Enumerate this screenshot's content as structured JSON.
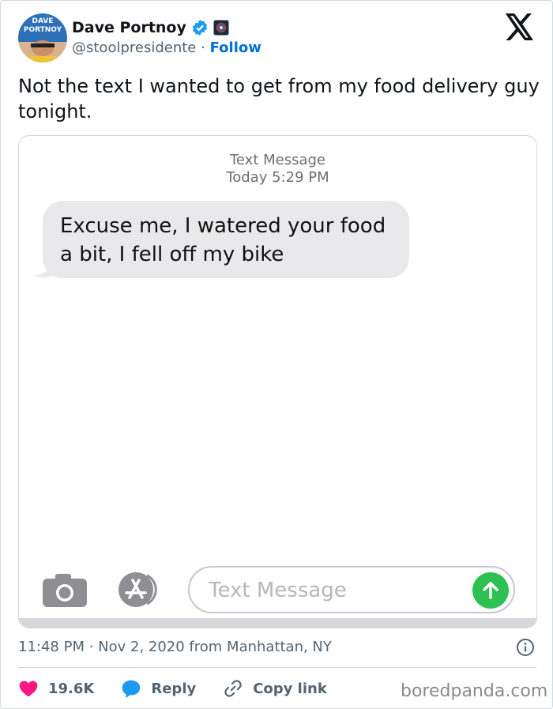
{
  "author": {
    "display_name": "Dave Portnoy",
    "handle": "@stoolpresidente",
    "separator": "·",
    "follow_label": "Follow",
    "avatar_text": [
      "DAVE",
      "PORTNOY"
    ]
  },
  "tweet": {
    "text": "Not the text I wanted to get from my food delivery guy tonight.",
    "timestamp": "11:48 PM · Nov 2, 2020 from Manhattan, NY"
  },
  "message_screenshot": {
    "meta_line1": "Text Message",
    "meta_line2": "Today 5:29 PM",
    "bubble_text": "Excuse me, I watered your food a bit, I fell off my bike",
    "input_placeholder": "Text Message"
  },
  "actions": {
    "like_count": "19.6K",
    "reply_label": "Reply",
    "copy_link_label": "Copy link"
  },
  "watermark": "boredpanda.com",
  "colors": {
    "like": "#f91880",
    "reply": "#1d9bf0",
    "follow": "#006fd6",
    "send": "#2ec052",
    "verified": "#1d9bf0"
  },
  "icons": [
    "x-logo-icon",
    "verified-icon",
    "camera-icon",
    "app-store-icon",
    "send-arrow-icon",
    "info-icon",
    "heart-icon",
    "reply-bubble-icon",
    "link-icon"
  ]
}
